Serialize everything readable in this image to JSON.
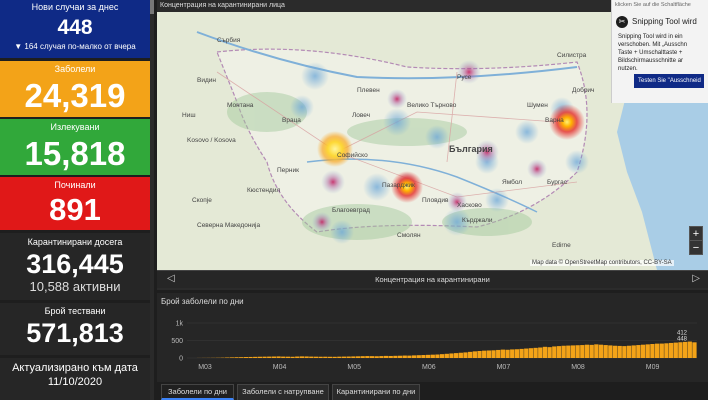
{
  "cards": {
    "new_today": {
      "title": "Нови случаи за днес",
      "value": "448",
      "sub": "▼ 164 случая по-малко от вчера"
    },
    "sick": {
      "title": "Заболели",
      "value": "24,319"
    },
    "healed": {
      "title": "Излекувани",
      "value": "15,818"
    },
    "died": {
      "title": "Починали",
      "value": "891"
    },
    "quarantined": {
      "title": "Карантинирани досега",
      "value": "316,445",
      "sub": "10,588 активни"
    },
    "tested": {
      "title": "Брой тествани",
      "value": "571,813"
    },
    "updated": {
      "title": "Актуализирано към дата",
      "value": "11/10/2020"
    }
  },
  "map": {
    "title": "Концентрация на карантинирани лица",
    "attribution": "Map data © OpenStreetMap contributors, CC-BY-SA",
    "labels": [
      "Сърбия",
      "Видин",
      "Монтана",
      "Враца",
      "Плевен",
      "Русе",
      "Силистра",
      "Варна",
      "Добрич",
      "Шумен",
      "Велико Търново",
      "Ловеч",
      "България",
      "Софийско",
      "Ямбол",
      "Бургас",
      "Хасково",
      "Пазарджик",
      "Пловдив",
      "Кърджали",
      "Смолян",
      "Благоевград",
      "Кюстендил",
      "Перник",
      "Kosovo / Kosova",
      "Северна Македонија",
      "Скопје",
      "Ниш",
      "Edirne"
    ],
    "carousel_caption": "Концентрация на карантинирани",
    "zoom_in": "+",
    "zoom_out": "−",
    "prev_icon": "◁",
    "next_icon": "▷"
  },
  "snipping_toast": {
    "top_line": "klicken Sie auf die Schaltfläche",
    "title": "Snipping Tool wird",
    "body": "Snipping Tool wird in ein verschoben. Mit „Ausschn Taste + Umschalttaste + Bildschirmausschnitte ar nutzen.",
    "button": "Testen Sie \"Ausschneid"
  },
  "chart_data": {
    "type": "bar",
    "title": "Брой заболели по дни",
    "x_ticks": [
      "M03",
      "M04",
      "M05",
      "M06",
      "M07",
      "M08",
      "M09"
    ],
    "y_ticks": [
      "1k",
      "500",
      "0"
    ],
    "ylim": [
      0,
      1000
    ],
    "color": "#f3a318",
    "annotations": [
      "412",
      "448"
    ],
    "values": [
      2,
      3,
      4,
      5,
      7,
      10,
      14,
      18,
      22,
      24,
      28,
      30,
      33,
      36,
      38,
      40,
      42,
      45,
      40,
      38,
      35,
      42,
      46,
      44,
      40,
      38,
      36,
      37,
      35,
      34,
      38,
      40,
      42,
      45,
      48,
      52,
      55,
      53,
      50,
      55,
      60,
      58,
      62,
      65,
      70,
      68,
      75,
      80,
      85,
      90,
      95,
      100,
      110,
      120,
      130,
      140,
      150,
      160,
      175,
      190,
      200,
      210,
      215,
      220,
      230,
      240,
      235,
      245,
      250,
      260,
      270,
      280,
      290,
      300,
      320,
      310,
      330,
      340,
      350,
      355,
      360,
      365,
      370,
      380,
      375,
      390,
      380,
      370,
      360,
      350,
      345,
      340,
      350,
      360,
      370,
      380,
      390,
      400,
      410,
      412,
      420,
      430,
      440,
      450,
      460,
      470,
      448
    ]
  },
  "tabs": [
    "Заболели по дни",
    "Заболели с натрупване",
    "Карантинирани по дни"
  ],
  "colors": {
    "blue": "#0f2a86",
    "orange": "#f3a318",
    "green": "#31a83a",
    "red": "#e01818",
    "panel": "#262626",
    "accent": "#3b82f6"
  }
}
